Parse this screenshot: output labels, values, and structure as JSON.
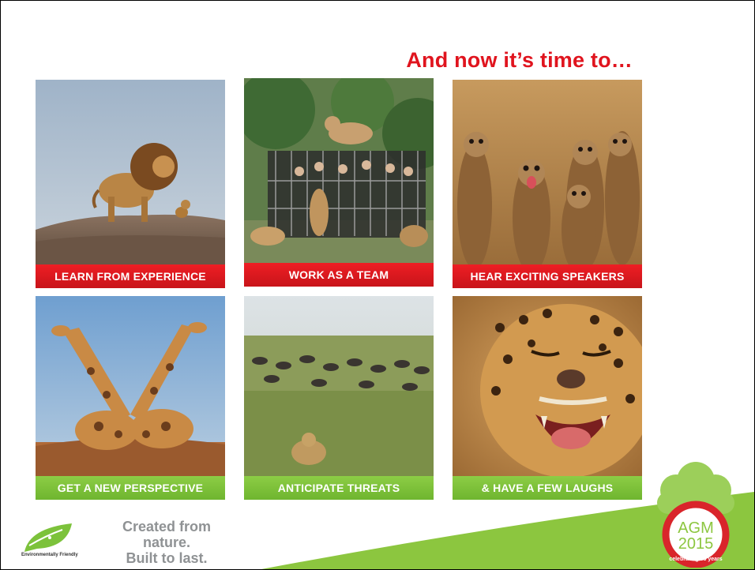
{
  "slide": {
    "title": "And now it’s time to…",
    "tiles": [
      {
        "caption": "LEARN FROM EXPERIENCE",
        "style": "red",
        "image": "lion-on-rock"
      },
      {
        "caption": "WORK AS A TEAM",
        "style": "red",
        "image": "lions-on-safari-truck"
      },
      {
        "caption": "HEAR EXCITING SPEAKERS",
        "style": "red",
        "image": "meerkats"
      },
      {
        "caption": "GET A NEW PERSPECTIVE",
        "style": "green",
        "image": "giraffes"
      },
      {
        "caption": "ANTICIPATE THREATS",
        "style": "green",
        "image": "lioness-and-wildebeest"
      },
      {
        "caption": "& HAVE A FEW LAUGHS",
        "style": "green",
        "image": "laughing-leopard"
      }
    ],
    "footer": {
      "tagline_line1": "Created from nature.",
      "tagline_line2": "Built to last.",
      "eco_label": "Environmentally Friendly",
      "agm_text": "AGM",
      "agm_year": "2015",
      "agm_ring": "celebrating 55 years"
    },
    "colors": {
      "title_red": "#e0141e",
      "caption_red": "#e01a20",
      "caption_green": "#7cc23b",
      "footer_green": "#8cc63f"
    }
  }
}
